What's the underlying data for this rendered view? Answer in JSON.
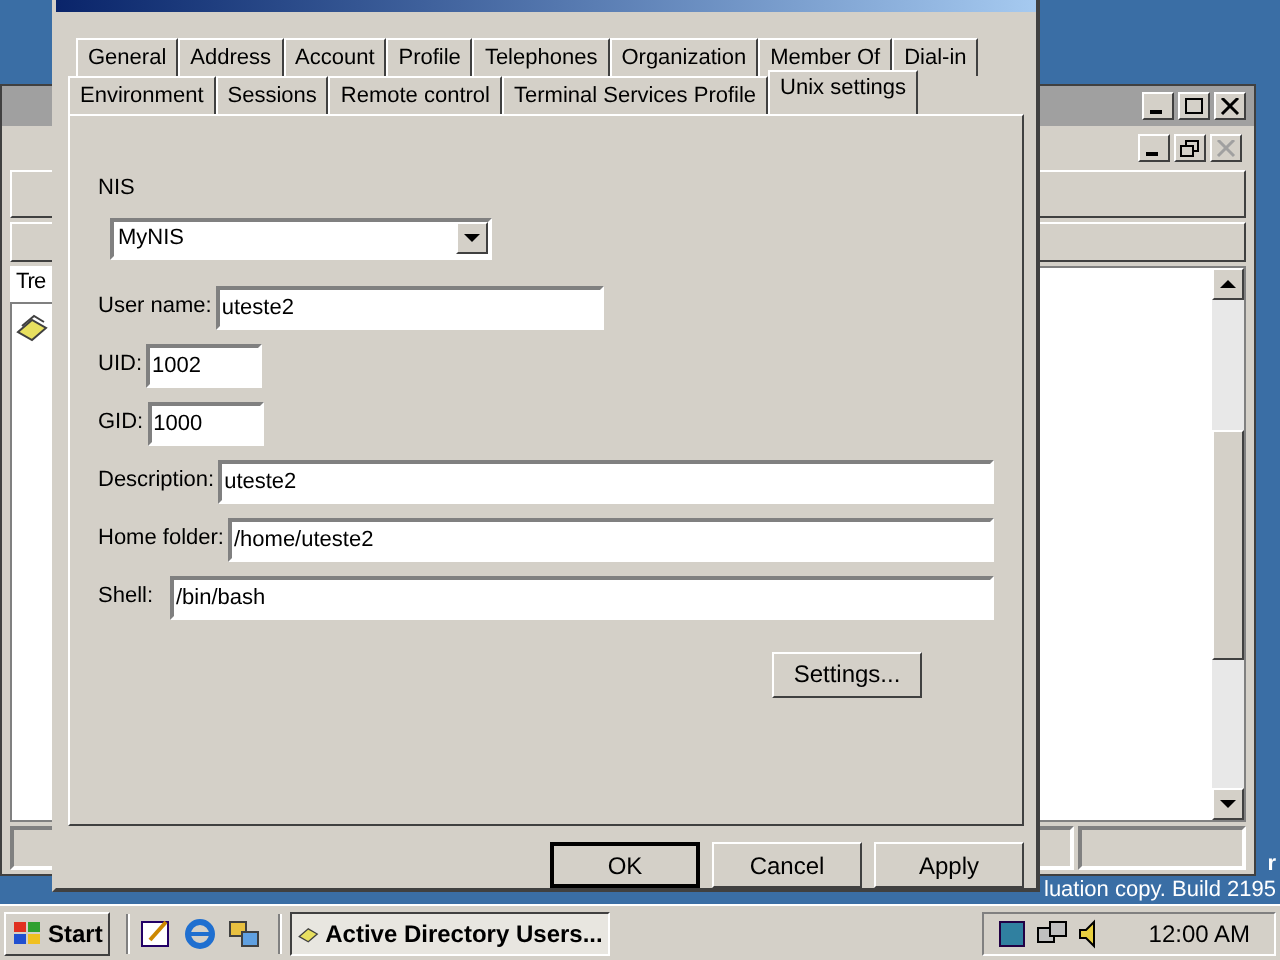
{
  "tabs_row1": [
    {
      "label": "General",
      "selected": false
    },
    {
      "label": "Address",
      "selected": false
    },
    {
      "label": "Account",
      "selected": false
    },
    {
      "label": "Profile",
      "selected": false
    },
    {
      "label": "Telephones",
      "selected": false
    },
    {
      "label": "Organization",
      "selected": false
    },
    {
      "label": "Member Of",
      "selected": false
    },
    {
      "label": "Dial-in",
      "selected": false
    }
  ],
  "tabs_row2": [
    {
      "label": "Environment",
      "selected": false
    },
    {
      "label": "Sessions",
      "selected": false
    },
    {
      "label": "Remote control",
      "selected": false
    },
    {
      "label": "Terminal Services Profile",
      "selected": false
    },
    {
      "label": "Unix settings",
      "selected": true
    }
  ],
  "nis": {
    "label": "NIS",
    "value": "MyNIS"
  },
  "fields": [
    {
      "label": "User name:",
      "value": "uteste2",
      "kind": "medium"
    },
    {
      "label": "UID:",
      "value": "1002",
      "kind": "short"
    },
    {
      "label": "GID:",
      "value": "1000",
      "kind": "short"
    },
    {
      "label": "Description:",
      "value": "uteste2",
      "kind": "long"
    },
    {
      "label": "Home folder:",
      "value": "/home/uteste2",
      "kind": "long"
    },
    {
      "label": "Shell:",
      "value": "/bin/bash",
      "kind": "long"
    }
  ],
  "settings_button": "Settings...",
  "buttons": [
    {
      "label": "OK",
      "default": true
    },
    {
      "label": "Cancel",
      "default": false
    },
    {
      "label": "Apply",
      "default": false
    }
  ],
  "background_window": {
    "tree_tab": "Tre"
  },
  "desktop_text": [
    "r",
    "luation copy. Build 2195"
  ],
  "taskbar": {
    "start": "Start",
    "task": "Active Directory Users...",
    "clock": "12:00 AM"
  }
}
